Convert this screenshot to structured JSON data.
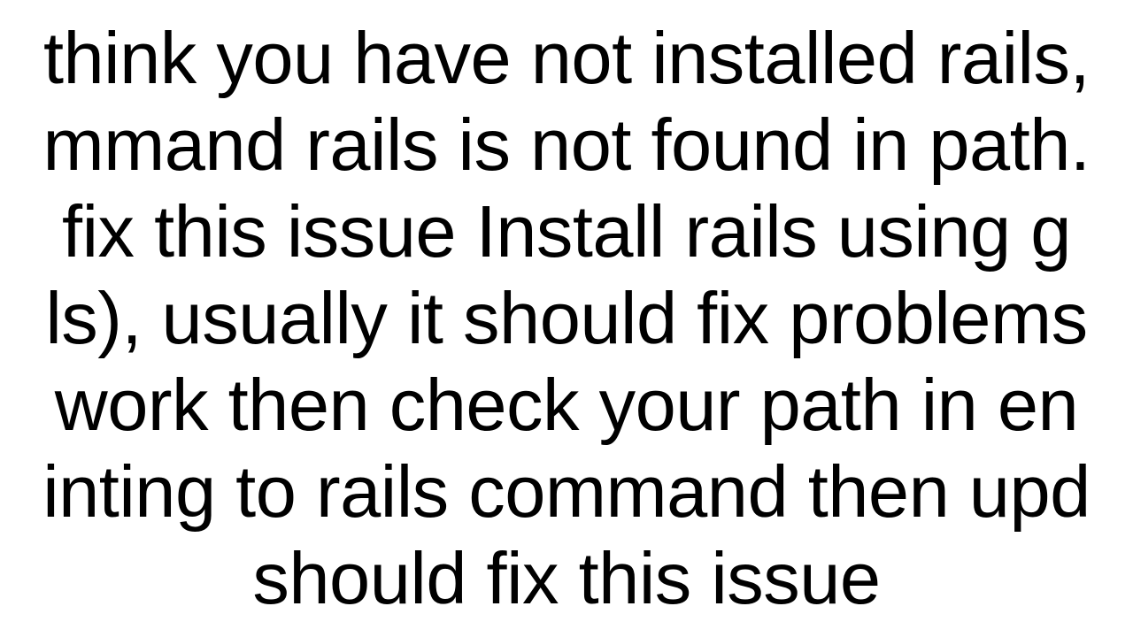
{
  "document": {
    "lines": [
      "think you have not installed rails,",
      "mmand rails is not found in path.",
      "fix this issue  Install rails using g",
      "ls), usually it should fix problems",
      " work then check your path in en",
      "inting to rails command then upd",
      "should fix this issue"
    ]
  }
}
